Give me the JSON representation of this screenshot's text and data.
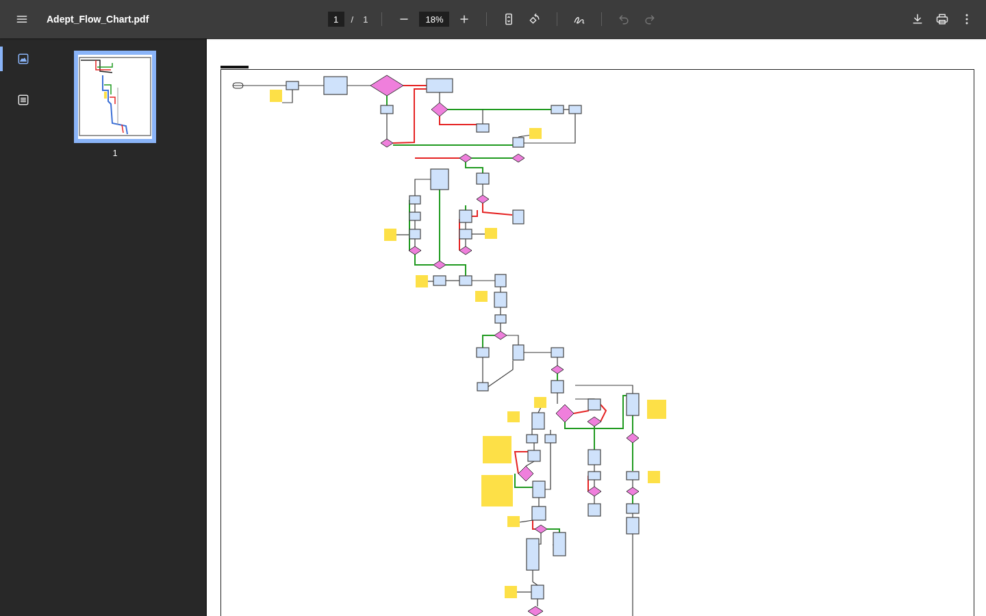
{
  "toolbar": {
    "title": "Adept_Flow_Chart.pdf",
    "page_field": {
      "value": "1"
    },
    "page_separator": "/",
    "page_total": "1",
    "zoom_field": {
      "value": "18%"
    },
    "undo": {
      "disabled": true
    },
    "redo": {
      "disabled": true
    }
  },
  "sidebar": {
    "tabs": [
      {
        "kind": "thumbnails",
        "selected": true
      },
      {
        "kind": "outline",
        "selected": false
      }
    ],
    "thumbnails": [
      {
        "label": "1",
        "selected": true
      }
    ]
  },
  "document": {
    "pages": [
      {
        "kind": "flowchart"
      }
    ]
  }
}
